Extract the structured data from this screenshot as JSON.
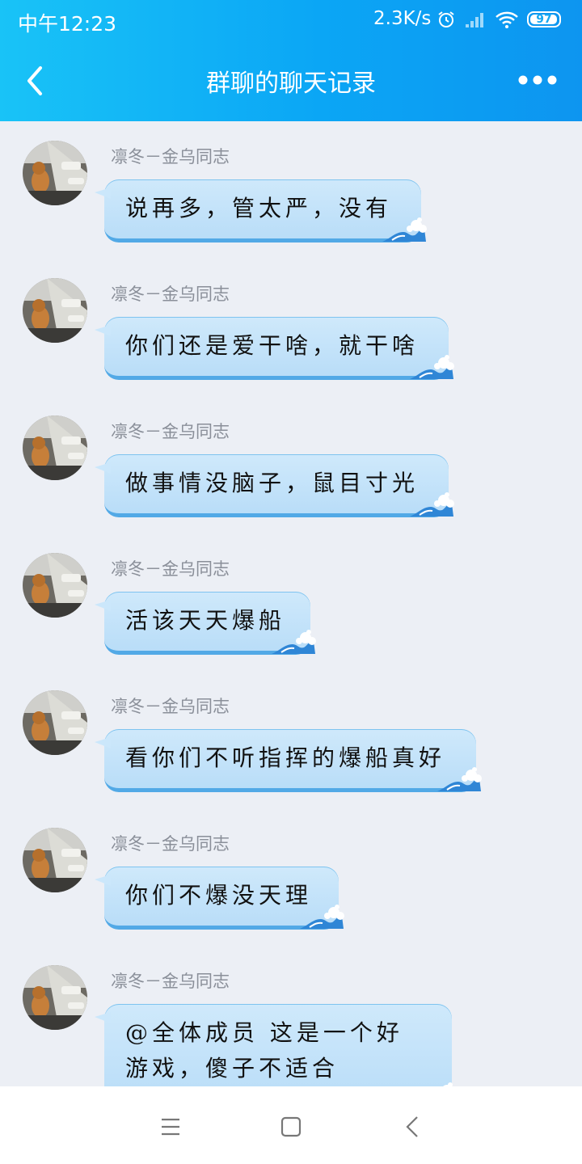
{
  "status_bar": {
    "time": "中午12:23",
    "network_speed": "2.3K/s",
    "battery_level": "97",
    "icons": [
      "alarm-icon",
      "signal-icon",
      "wifi-icon",
      "battery-icon"
    ]
  },
  "header": {
    "title": "群聊的聊天记录",
    "back_icon": "chevron-left-icon",
    "more_icon": "more-dots-icon"
  },
  "messages": [
    {
      "sender": "凛冬－金乌同志",
      "text": "说再多，管太严，没有"
    },
    {
      "sender": "凛冬－金乌同志",
      "text": "你们还是爱干啥，就干啥"
    },
    {
      "sender": "凛冬－金乌同志",
      "text": "做事情没脑子，鼠目寸光"
    },
    {
      "sender": "凛冬－金乌同志",
      "text": "活该天天爆船"
    },
    {
      "sender": "凛冬－金乌同志",
      "text": "看你们不听指挥的爆船真好"
    },
    {
      "sender": "凛冬－金乌同志",
      "text": "你们不爆没天理"
    },
    {
      "sender": "凛冬－金乌同志",
      "text": "@全体成员 这是一个好游戏，傻子不适合"
    }
  ],
  "bottom_nav": {
    "menu_icon": "menu-icon",
    "home_icon": "home-square-icon",
    "back_icon": "back-triangle-icon"
  },
  "colors": {
    "header_start": "#19c3f7",
    "header_end": "#0d95f0",
    "background": "#eceff5",
    "bubble": "#c4e3fa",
    "bubble_border": "#52a9e6"
  }
}
